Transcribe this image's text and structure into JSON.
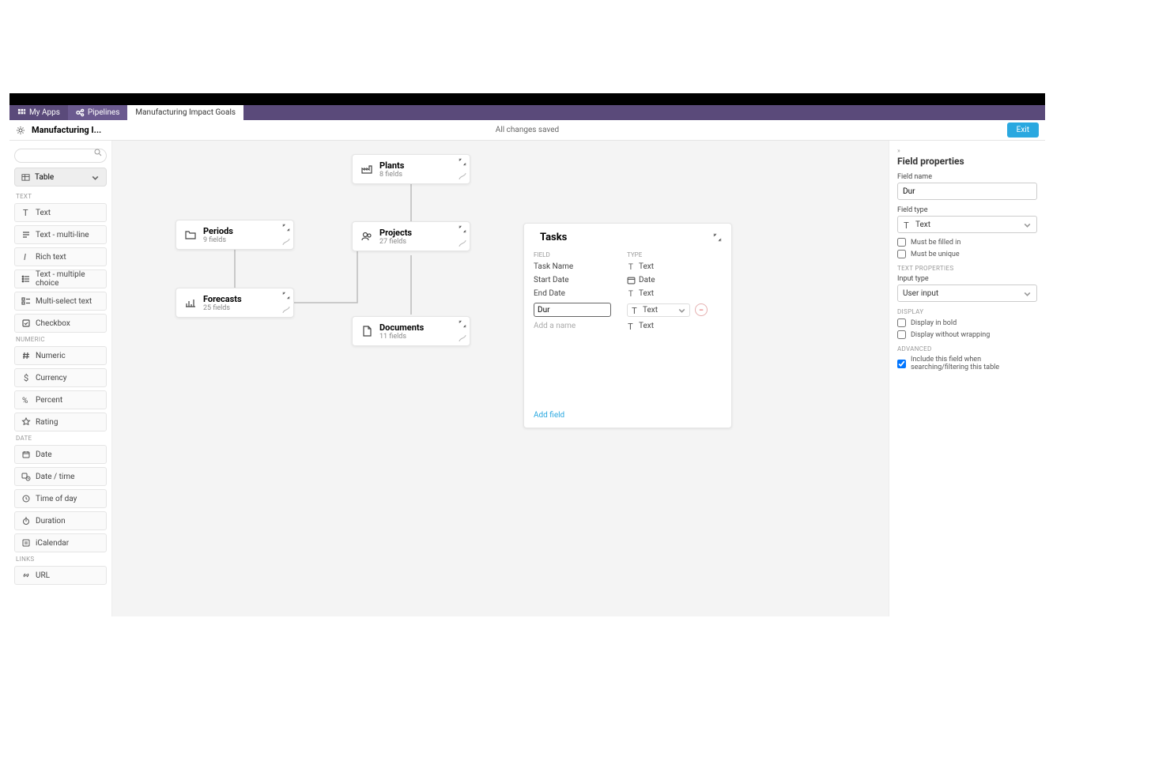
{
  "nav": {
    "my_apps": "My Apps",
    "pipelines": "Pipelines",
    "active_tab": "Manufacturing Impact Goals"
  },
  "toolbar": {
    "title": "Manufacturing I...",
    "saved": "All changes saved",
    "exit": "Exit"
  },
  "sidebar": {
    "table_dropdown": "Table",
    "groups": [
      {
        "label": "TEXT",
        "items": [
          {
            "icon": "T",
            "label": "Text"
          },
          {
            "icon": "lines",
            "label": "Text - multi-line"
          },
          {
            "icon": "italic",
            "label": "Rich text"
          },
          {
            "icon": "list",
            "label": "Text - multiple choice"
          },
          {
            "icon": "multiselect",
            "label": "Multi-select text"
          },
          {
            "icon": "check",
            "label": "Checkbox"
          }
        ]
      },
      {
        "label": "NUMERIC",
        "items": [
          {
            "icon": "hash",
            "label": "Numeric"
          },
          {
            "icon": "dollar",
            "label": "Currency"
          },
          {
            "icon": "percent",
            "label": "Percent"
          },
          {
            "icon": "star",
            "label": "Rating"
          }
        ]
      },
      {
        "label": "DATE",
        "items": [
          {
            "icon": "calendar",
            "label": "Date"
          },
          {
            "icon": "calclock",
            "label": "Date / time"
          },
          {
            "icon": "clock",
            "label": "Time of day"
          },
          {
            "icon": "timer",
            "label": "Duration"
          },
          {
            "icon": "ical",
            "label": "iCalendar"
          }
        ]
      },
      {
        "label": "LINKS",
        "items": [
          {
            "icon": "link",
            "label": "URL"
          }
        ]
      }
    ]
  },
  "canvas": {
    "nodes": {
      "plants": {
        "title": "Plants",
        "sub": "8 fields"
      },
      "periods": {
        "title": "Periods",
        "sub": "9 fields"
      },
      "projects": {
        "title": "Projects",
        "sub": "27 fields"
      },
      "forecasts": {
        "title": "Forecasts",
        "sub": "25 fields"
      },
      "documents": {
        "title": "Documents",
        "sub": "11 fields"
      }
    }
  },
  "card": {
    "title": "Tasks",
    "col_field": "FIELD",
    "col_type": "TYPE",
    "rows": [
      {
        "name": "Task Name",
        "type_icon": "T",
        "type": "Text"
      },
      {
        "name": "Start Date",
        "type_icon": "cal",
        "type": "Date"
      },
      {
        "name": "End Date",
        "type_icon": "T",
        "type": "Text"
      }
    ],
    "editing_name": "Dur",
    "editing_type": "Text",
    "extra_type": "Text",
    "add_placeholder": "Add a name",
    "add_field": "Add field"
  },
  "props": {
    "crumb": "»",
    "title": "Field properties",
    "name_label": "Field name",
    "name_value": "Dur",
    "type_label": "Field type",
    "type_value": "Text",
    "must_filled": "Must be filled in",
    "must_unique": "Must be unique",
    "section_textprops": "TEXT PROPERTIES",
    "input_type_label": "Input type",
    "input_type_value": "User input",
    "section_display": "DISPLAY",
    "display_bold": "Display in bold",
    "display_nowrap": "Display without wrapping",
    "section_advanced": "ADVANCED",
    "include_search": "Include this field when searching/filtering this table"
  }
}
